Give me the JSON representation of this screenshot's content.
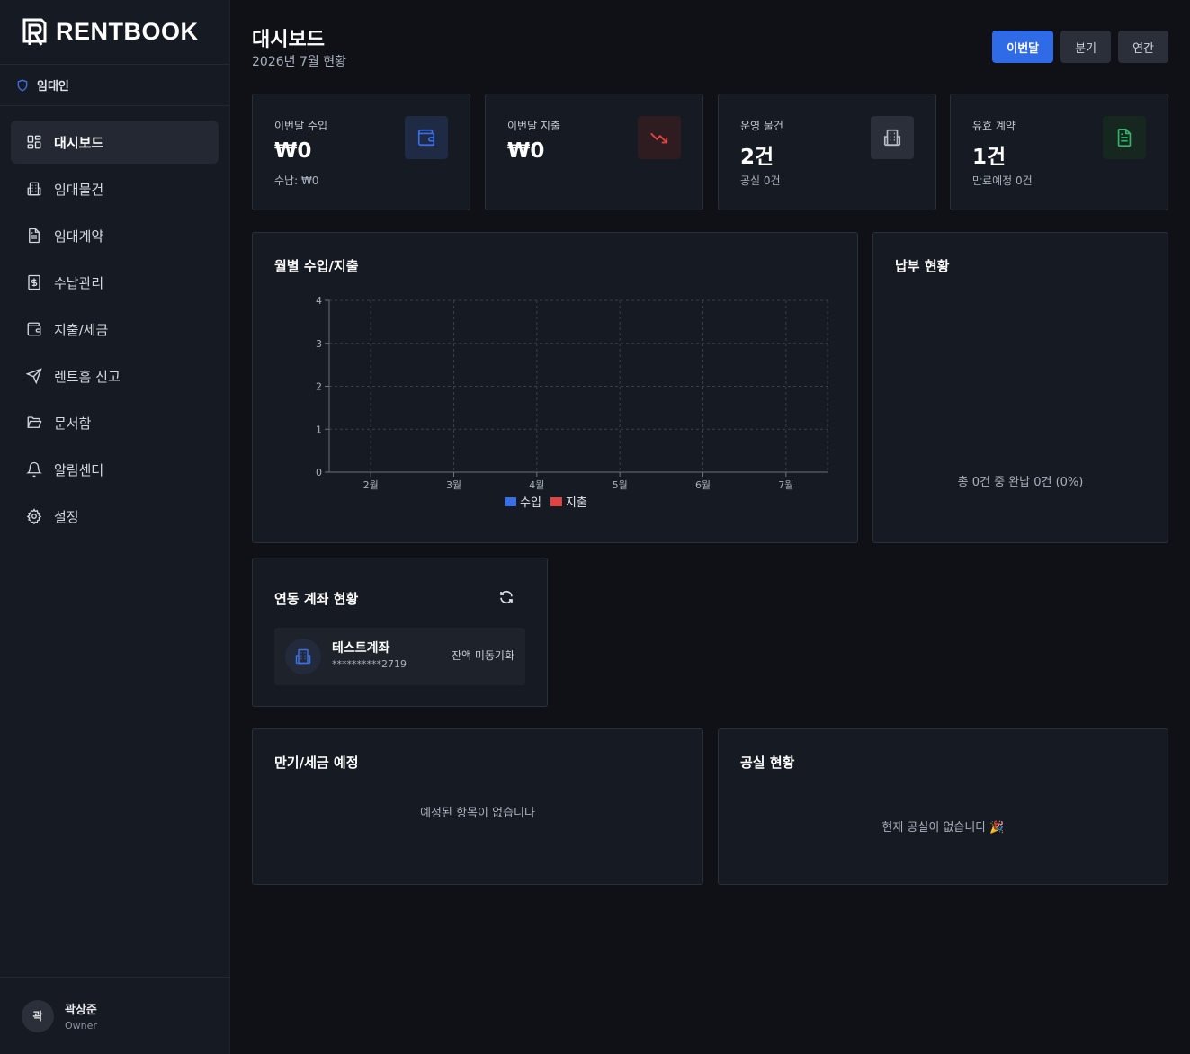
{
  "brand": {
    "name": "RENTBOOK"
  },
  "role": {
    "label": "임대인"
  },
  "nav": [
    {
      "label": "대시보드",
      "icon": "dashboard-grid-icon",
      "active": true
    },
    {
      "label": "임대물건",
      "icon": "building-icon"
    },
    {
      "label": "임대계약",
      "icon": "document-icon"
    },
    {
      "label": "수납관리",
      "icon": "dollar-receipt-icon"
    },
    {
      "label": "지출/세금",
      "icon": "wallet-icon"
    },
    {
      "label": "렌트홈 신고",
      "icon": "send-icon"
    },
    {
      "label": "문서함",
      "icon": "folder-open-icon"
    },
    {
      "label": "알림센터",
      "icon": "bell-icon"
    },
    {
      "label": "설정",
      "icon": "gear-icon"
    }
  ],
  "user": {
    "avatar": "곽",
    "name": "곽상준",
    "role": "Owner"
  },
  "header": {
    "title": "대시보드",
    "subtitle": "2026년 7월 현황"
  },
  "periods": [
    {
      "label": "이번달",
      "active": true
    },
    {
      "label": "분기"
    },
    {
      "label": "연간"
    }
  ],
  "stats": [
    {
      "label": "이번달 수입",
      "value": "₩0",
      "sub": "수납: ₩0",
      "icon": "wallet-icon",
      "color": "#3b6fe6"
    },
    {
      "label": "이번달 지출",
      "value": "₩0",
      "sub": "",
      "icon": "trending-down-icon",
      "color": "#e04545"
    },
    {
      "label": "운영 물건",
      "value": "2건",
      "sub": "공실 0건",
      "icon": "building-icon",
      "color": "#b8bec8"
    },
    {
      "label": "유효 계약",
      "value": "1건",
      "sub": "만료예정 0건",
      "icon": "document-icon",
      "color": "#2fb86a"
    }
  ],
  "monthly": {
    "title": "월별 수입/지출"
  },
  "chart_data": {
    "type": "bar",
    "categories": [
      "2월",
      "3월",
      "4월",
      "5월",
      "6월",
      "7월"
    ],
    "series": [
      {
        "name": "수입",
        "values": [
          0,
          0,
          0,
          0,
          0,
          0
        ],
        "color": "#3b6fe6"
      },
      {
        "name": "지출",
        "values": [
          0,
          0,
          0,
          0,
          0,
          0
        ],
        "color": "#e04545"
      }
    ],
    "ylim": [
      0,
      4
    ],
    "yticks": [
      "0",
      "1",
      "2",
      "3",
      "4"
    ],
    "grid": true,
    "legend": "bottom"
  },
  "payment": {
    "title": "납부 현황",
    "summary": "총 0건 중 완납 0건 (0%)"
  },
  "accounts": {
    "title": "연동 계좌 현황",
    "items": [
      {
        "name": "테스트계좌",
        "number": "**********2719",
        "balance": "잔액 미동기화"
      }
    ]
  },
  "upcoming": {
    "title": "만기/세금 예정",
    "empty": "예정된 항목이 없습니다"
  },
  "vacancy": {
    "title": "공실 현황",
    "empty": "현재 공실이 없습니다 🎉"
  }
}
